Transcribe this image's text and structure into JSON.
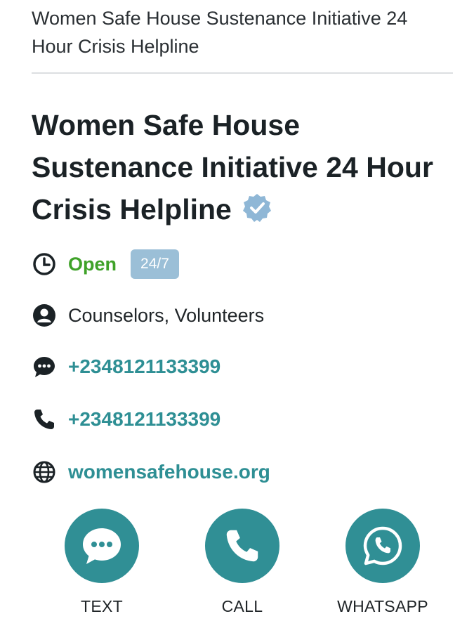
{
  "header": {
    "title": "Women Safe House Sustenance Initiative 24 Hour Crisis Helpline"
  },
  "listing": {
    "name": "Women Safe House Sustenance Initiative 24 Hour Crisis Helpline",
    "verified_icon": "verified-badge-icon",
    "status": "Open",
    "hours_badge": "24/7",
    "staff": "Counselors, Volunteers",
    "sms_number": "+2348121133399",
    "phone_number": "+2348121133399",
    "website": "womensafehouse.org"
  },
  "actions": {
    "text_label": "TEXT",
    "call_label": "CALL",
    "whatsapp_label": "WHATSAPP"
  },
  "colors": {
    "accent": "#308f95",
    "link": "#2e8f94",
    "open": "#3fa229",
    "badge": "#9bbfd7",
    "verified": "#8fb7d6"
  }
}
